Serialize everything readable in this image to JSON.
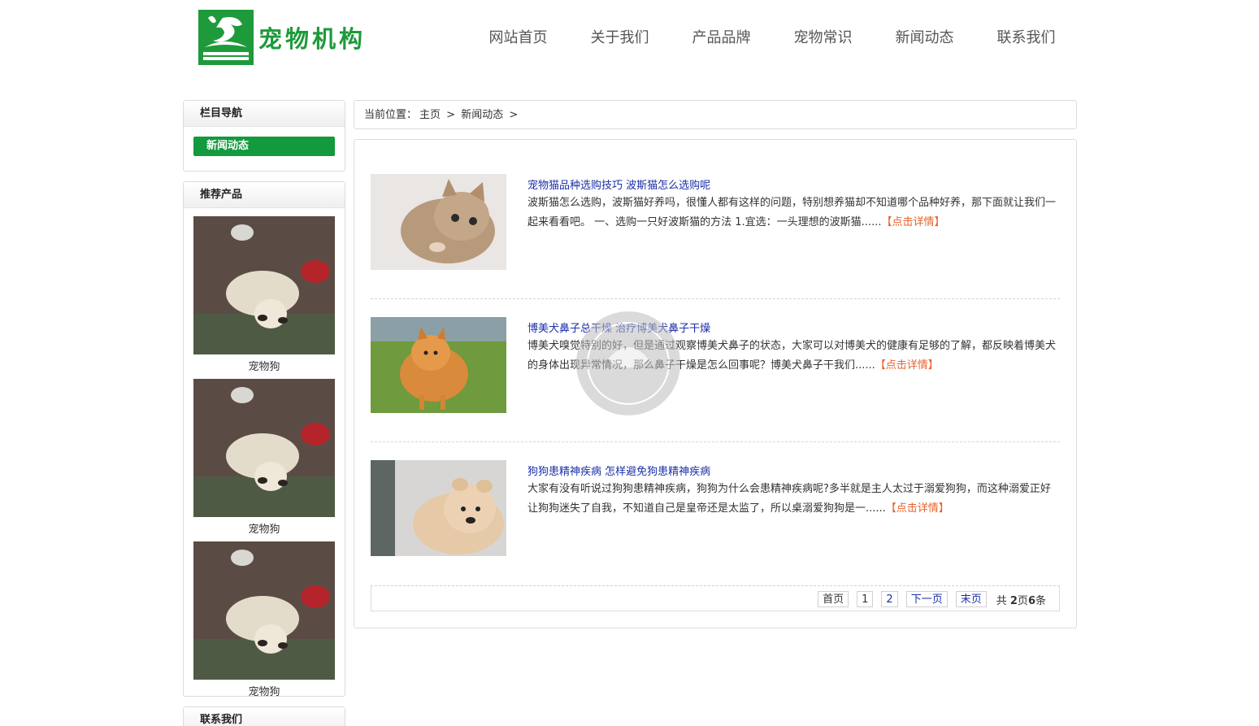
{
  "header": {
    "logo_text": "宠物机构",
    "nav": [
      "网站首页",
      "关于我们",
      "产品品牌",
      "宠物常识",
      "新闻动态",
      "联系我们"
    ]
  },
  "sidebar": {
    "nav_title": "栏目导航",
    "nav_active": "新闻动态",
    "products_title": "推荐产品",
    "products": [
      {
        "name": "宠物狗"
      },
      {
        "name": "宠物狗"
      },
      {
        "name": "宠物狗"
      }
    ],
    "contact_title": "联系我们"
  },
  "breadcrumb": {
    "label": "当前位置：",
    "home": "主页",
    "sep": ">",
    "current": "新闻动态"
  },
  "articles": [
    {
      "title": "宠物猫品种选购技巧 波斯猫怎么选购呢",
      "summary": "波斯猫怎么选购，波斯猫好养吗，很懂人都有这样的问题，特别想养猫却不知道哪个品种好养，那下面就让我们一起来看看吧。 一、选购一只好波斯猫的方法 1.宜选：一头理想的波斯猫......",
      "more": "【点击详情】"
    },
    {
      "title": "博美犬鼻子总干燥 治疗博美犬鼻子干燥",
      "summary": "博美犬嗅觉特别的好，但是通过观察博美犬鼻子的状态，大家可以对博美犬的健康有足够的了解，都反映着博美犬的身体出现异常情况，那么鼻子干燥是怎么回事呢？博美犬鼻子干我们......",
      "more": "【点击详情】"
    },
    {
      "title": "狗狗患精神疾病 怎样避免狗患精神疾病",
      "summary": "大家有没有听说过狗狗患精神疾病，狗狗为什么会患精神疾病呢?多半就是主人太过于溺爱狗狗，而这种溺爱正好让狗狗迷失了自我，不知道自己是皇帝还是太监了，所以桌溺爱狗狗是一......",
      "more": "【点击详情】"
    }
  ],
  "pager": {
    "first": "首页",
    "pages": [
      "1",
      "2"
    ],
    "next": "下一页",
    "last": "末页",
    "info_prefix": "共 ",
    "total_pages": "2",
    "info_mid": "页",
    "total_items": "6",
    "info_suffix": "条"
  },
  "colors": {
    "brand_green": "#139a3e",
    "link_blue": "#1c2fa8",
    "more_orange": "#e8622b"
  }
}
